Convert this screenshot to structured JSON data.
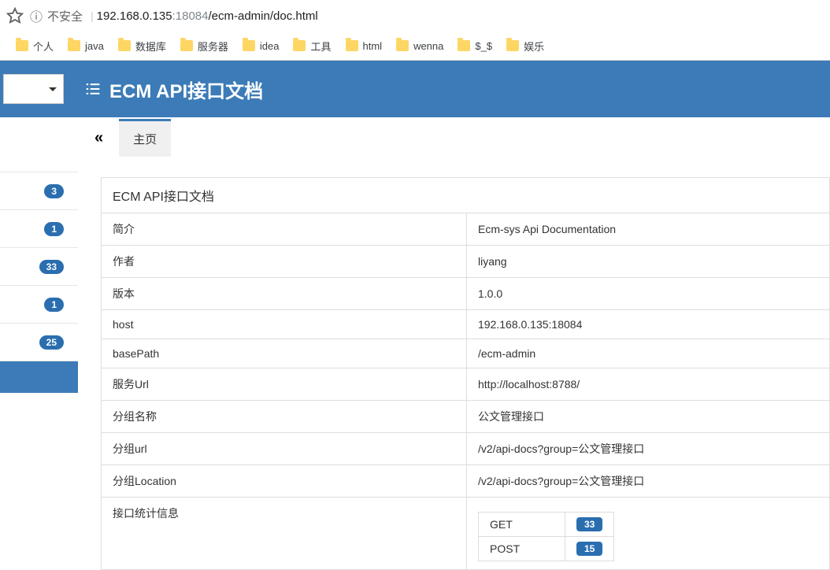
{
  "browser": {
    "not_secure": "不安全",
    "url_host": "192.168.0.135",
    "url_port": ":18084",
    "url_path": "/ecm-admin/doc.html"
  },
  "bookmarks": {
    "items": [
      {
        "label": "个人"
      },
      {
        "label": "java"
      },
      {
        "label": "数据库"
      },
      {
        "label": "服务器"
      },
      {
        "label": "idea"
      },
      {
        "label": "工具"
      },
      {
        "label": "html"
      },
      {
        "label": "wenna"
      },
      {
        "label": "$_$"
      },
      {
        "label": "娱乐"
      }
    ]
  },
  "header": {
    "title": "ECM API接口文档"
  },
  "sidebar": {
    "badges": [
      {
        "count": "3"
      },
      {
        "count": "1"
      },
      {
        "count": "33"
      },
      {
        "count": "1"
      },
      {
        "count": "25"
      }
    ]
  },
  "tabs": {
    "home": "主页"
  },
  "doc": {
    "title": "ECM API接口文档",
    "rows": [
      {
        "label": "简介",
        "value": "Ecm-sys Api Documentation"
      },
      {
        "label": "作者",
        "value": "liyang"
      },
      {
        "label": "版本",
        "value": "1.0.0"
      },
      {
        "label": "host",
        "value": "192.168.0.135:18084"
      },
      {
        "label": "basePath",
        "value": "/ecm-admin"
      },
      {
        "label": "服务Url",
        "value": "http://localhost:8788/"
      },
      {
        "label": "分组名称",
        "value": "公文管理接口"
      },
      {
        "label": "分组url",
        "value": "/v2/api-docs?group=公文管理接口"
      },
      {
        "label": "分组Location",
        "value": "/v2/api-docs?group=公文管理接口"
      }
    ],
    "stats_label": "接口统计信息",
    "stats": [
      {
        "method": "GET",
        "count": "33"
      },
      {
        "method": "POST",
        "count": "15"
      }
    ]
  }
}
